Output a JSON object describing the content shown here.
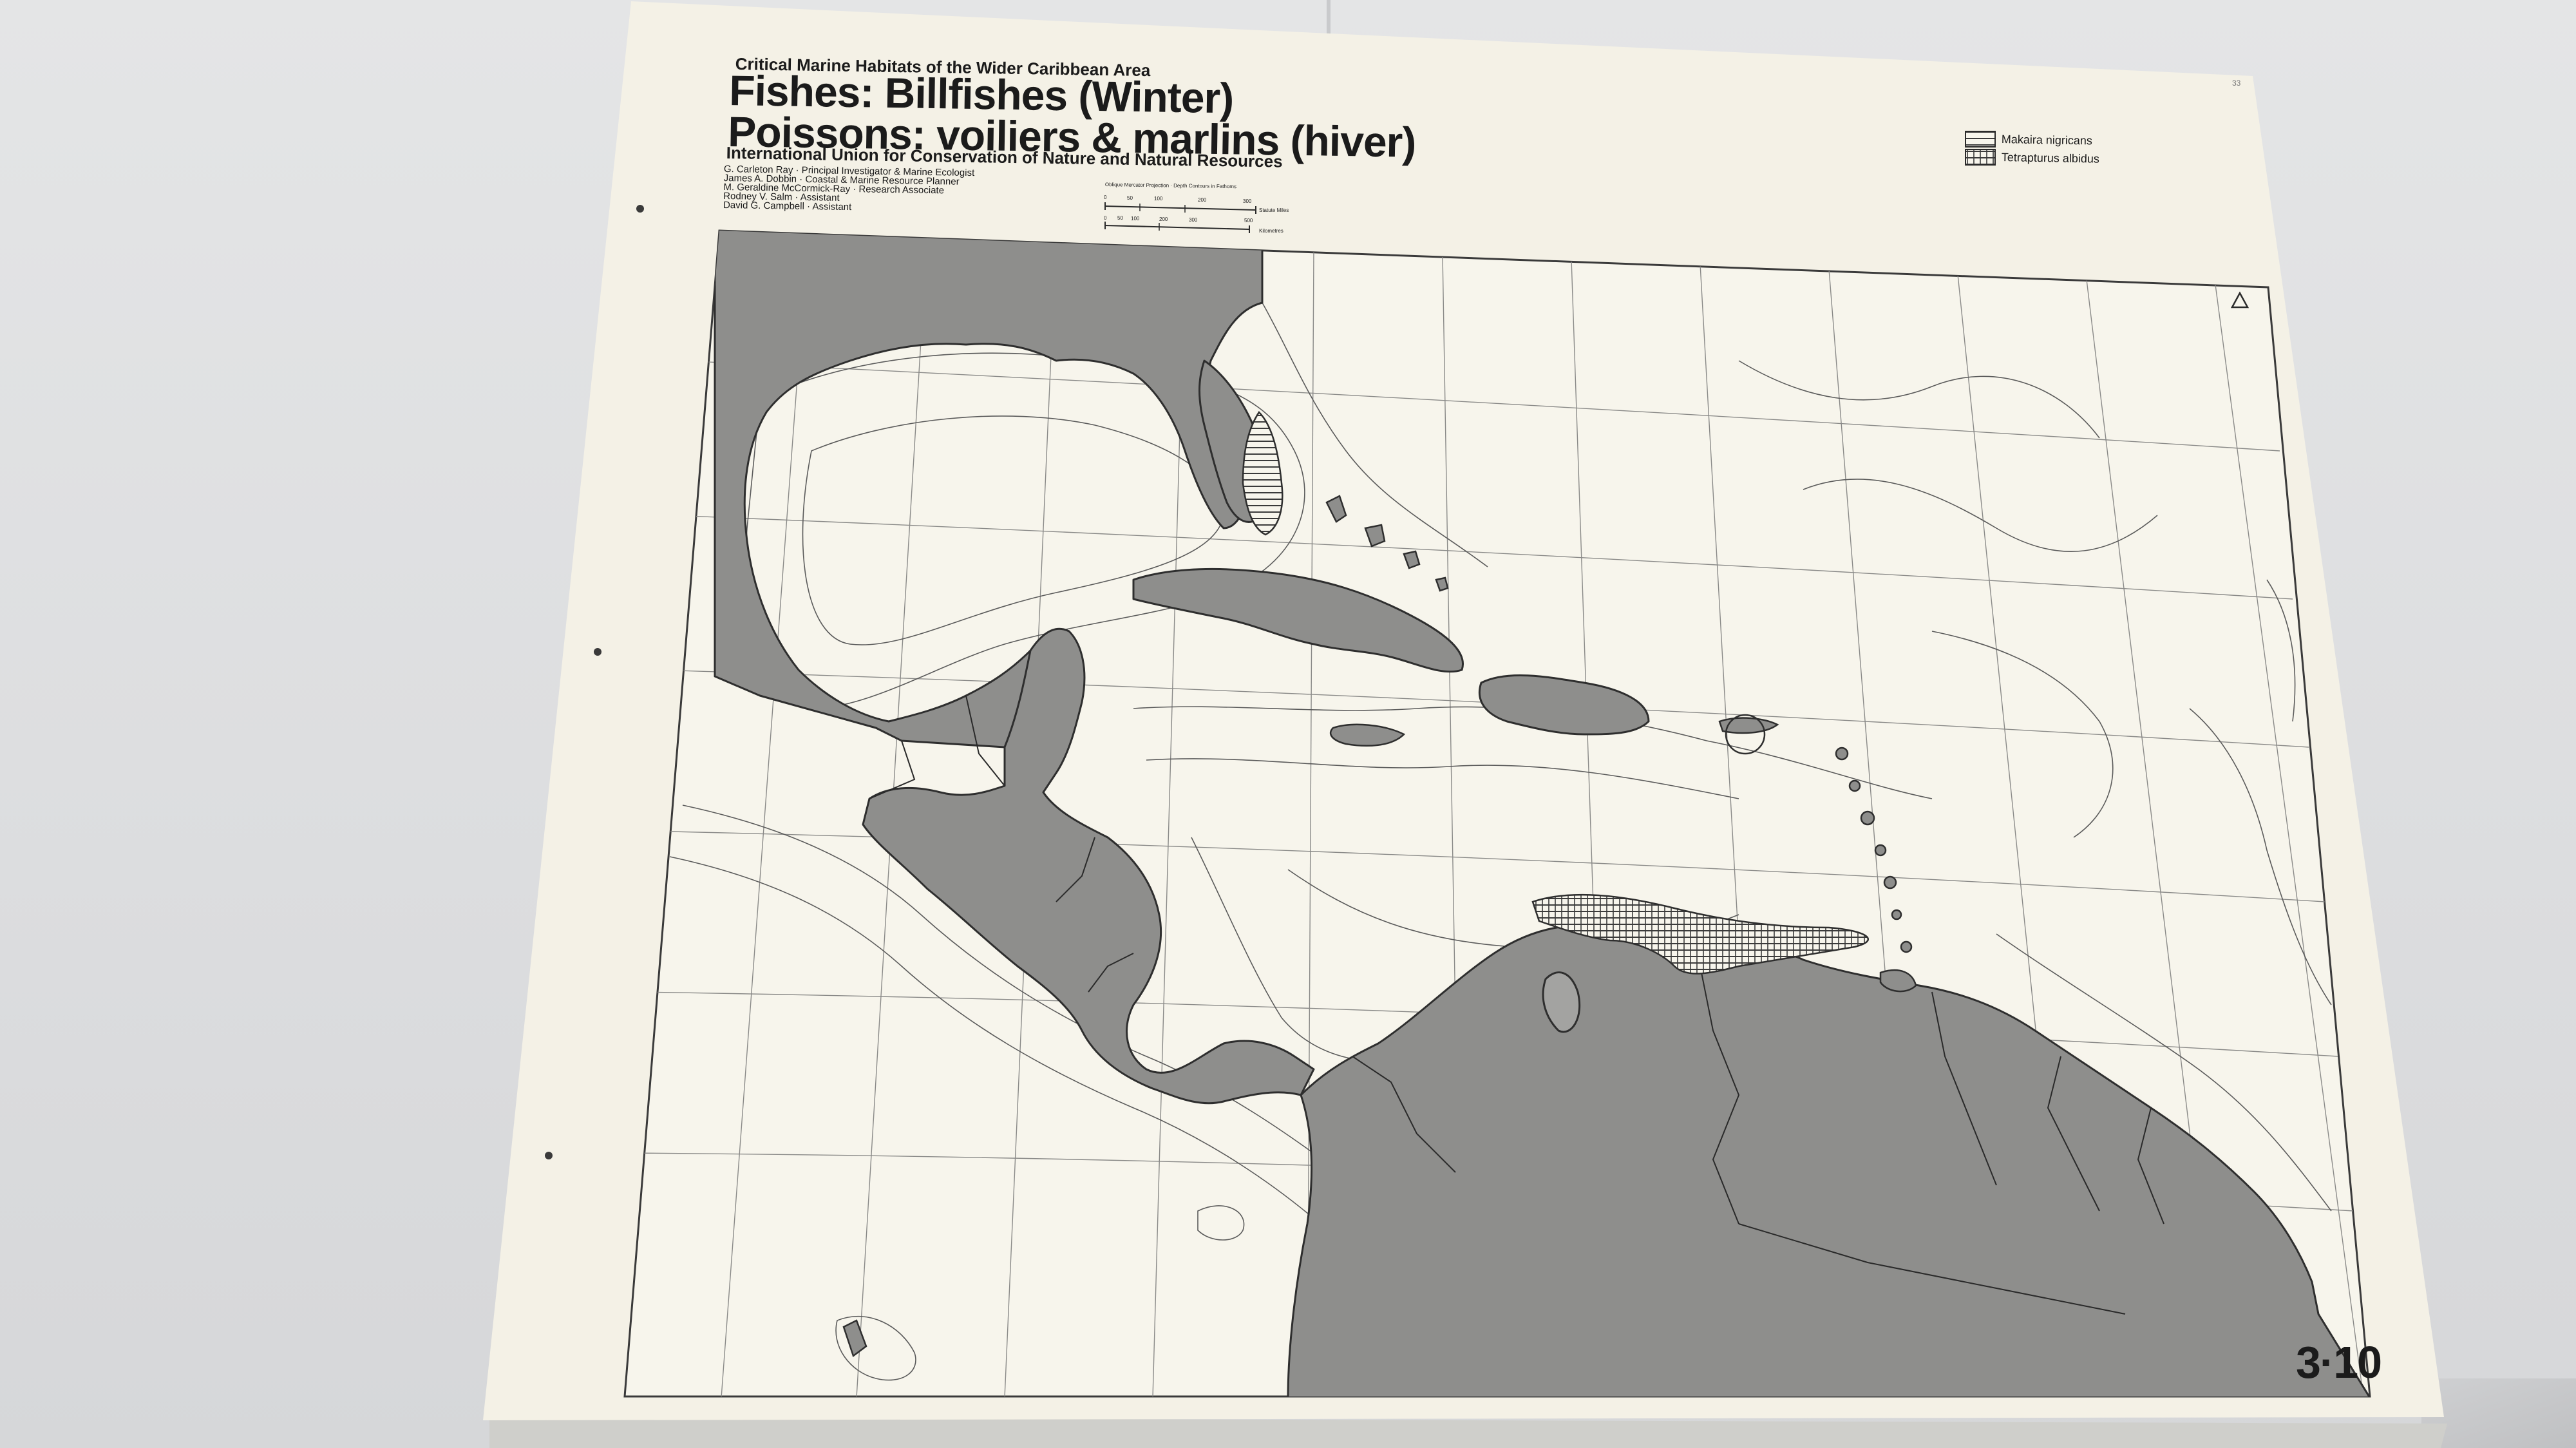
{
  "map": {
    "series_title": "Critical Marine Habitats of the Wider Caribbean Area",
    "title_en": "Fishes: Billfishes (Winter)",
    "title_fr": "Poissons: voiliers & marlins (hiver)",
    "organization": "International Union for Conservation of Nature and Natural Resources",
    "credits": [
      "G. Carleton Ray · Principal Investigator & Marine Ecologist",
      "James A. Dobbin · Coastal & Marine Resource Planner",
      "M. Geraldine McCormick-Ray · Research Associate",
      "Rodney V. Salm · Assistant",
      "David G. Campbell · Assistant"
    ],
    "projection_note": "Oblique Mercator Projection · Depth Contours in Fathoms",
    "scale": {
      "miles_label": "Statute Miles",
      "miles_ticks": [
        "0",
        "50",
        "100",
        "200",
        "300"
      ],
      "km_label": "Kilometres",
      "km_ticks": [
        "0",
        "50",
        "100",
        "200",
        "300",
        "500"
      ]
    },
    "legend": [
      {
        "label": "Makaira nigricans",
        "pattern": "horizontal-hatch"
      },
      {
        "label": "Tetrapturus albidus",
        "pattern": "vertical-hatch"
      }
    ],
    "north_marker": "triangle-north-icon",
    "sheet_number": "3·10",
    "page_ref": "33",
    "colors": {
      "paper": "#f4f1e6",
      "land": "#8e8e8c",
      "ocean": "#f7f5ec",
      "ink": "#1b1b1b"
    }
  }
}
